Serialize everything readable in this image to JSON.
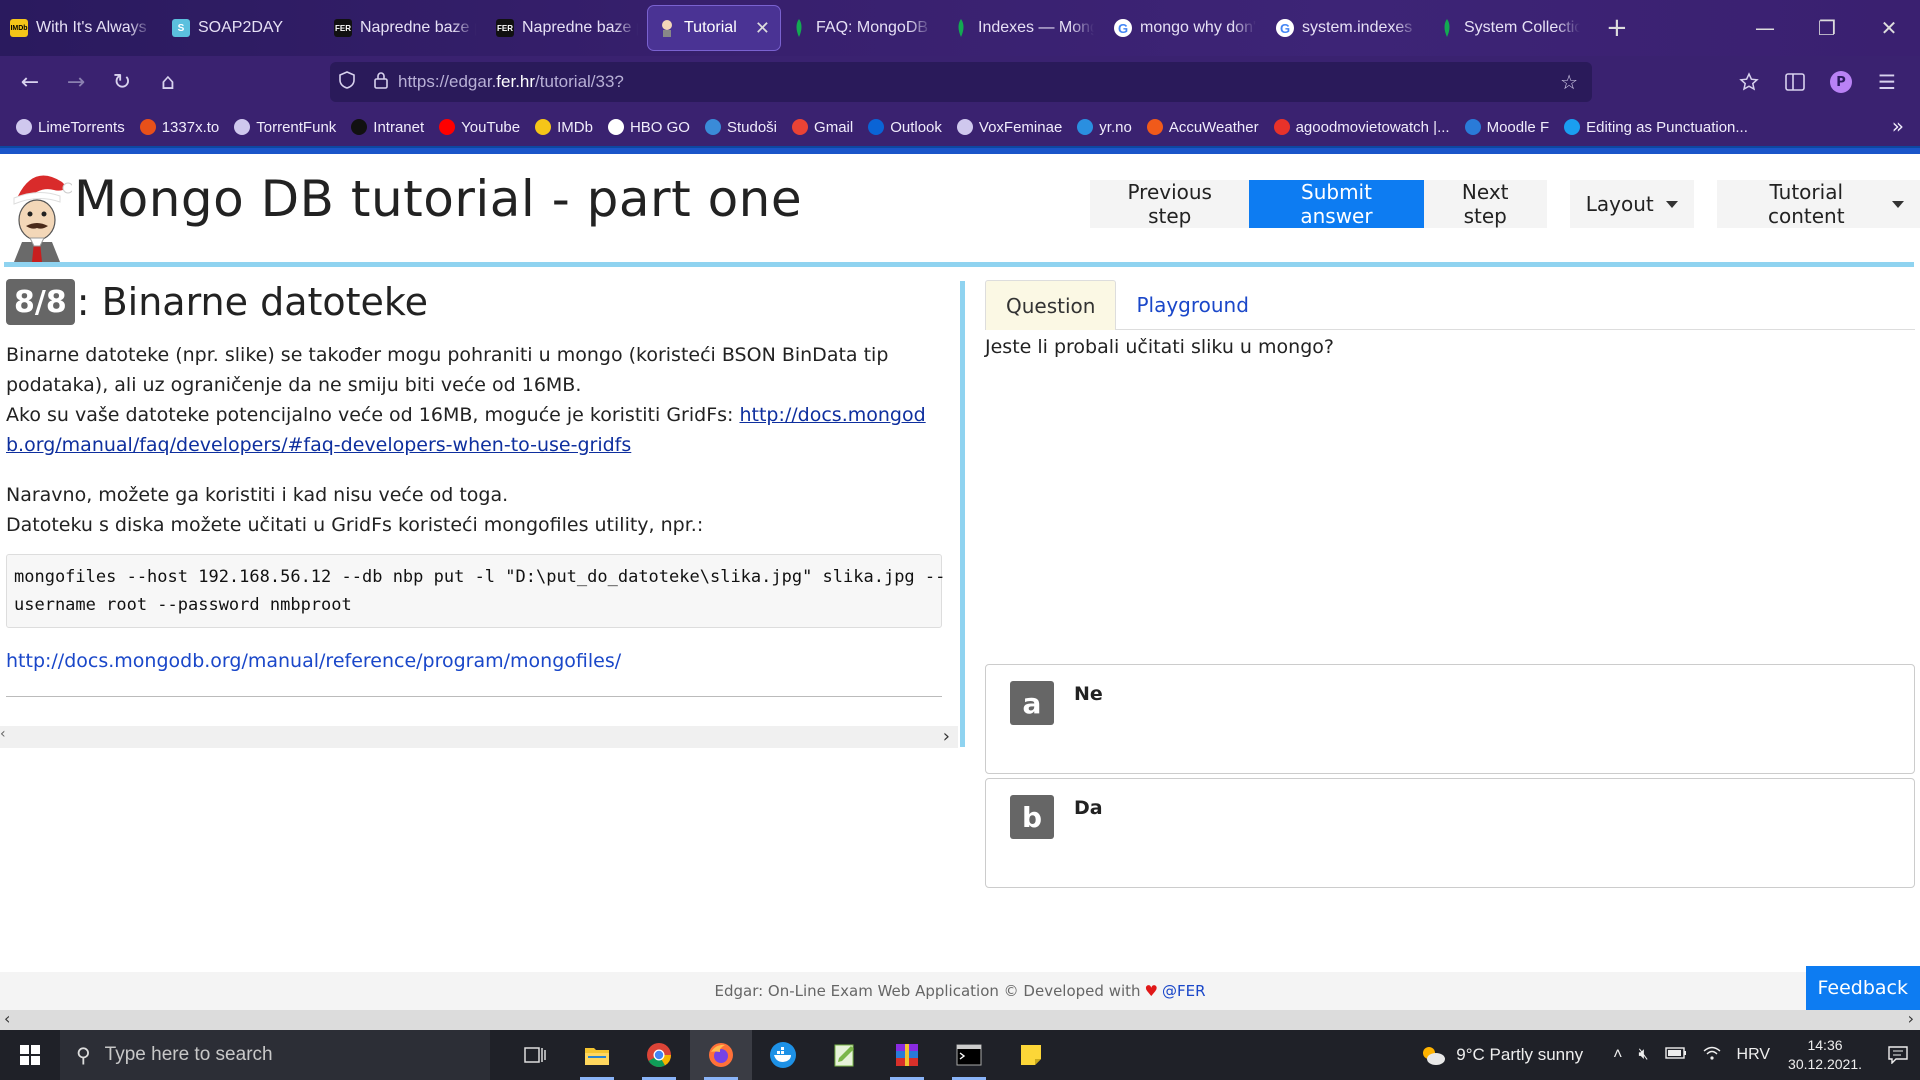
{
  "browser": {
    "tabs": [
      {
        "title": "With It's Always S",
        "favicon": "imdb",
        "color": "#f5c518",
        "active": false
      },
      {
        "title": "SOAP2DAY",
        "favicon": "soap",
        "color": "#5bc0de",
        "active": false
      },
      {
        "title": "Napredne baze p",
        "favicon": "fer",
        "color": "#111111",
        "active": false
      },
      {
        "title": "Napredne baze p",
        "favicon": "fer",
        "color": "#111111",
        "active": false
      },
      {
        "title": "Tutorial",
        "favicon": "edgar",
        "color": "#ffffff",
        "active": true
      },
      {
        "title": "FAQ: MongoDB F",
        "favicon": "mongo",
        "color": "#13aa52",
        "active": false
      },
      {
        "title": "Indexes — Mong",
        "favicon": "mongo",
        "color": "#13aa52",
        "active": false
      },
      {
        "title": "mongo why don't",
        "favicon": "google",
        "color": "#ffffff",
        "active": false
      },
      {
        "title": "system.indexes n",
        "favicon": "google",
        "color": "#ffffff",
        "active": false
      },
      {
        "title": "System Collectio",
        "favicon": "mongo",
        "color": "#13aa52",
        "active": false
      }
    ],
    "new_tab": "+",
    "window": {
      "minimize": "—",
      "restore": "❐",
      "close": "✕"
    },
    "nav": {
      "back": "←",
      "forward": "→",
      "reload": "↻",
      "home": "⌂"
    },
    "url": {
      "prefix": "https://edgar.",
      "domain": "fer.hr",
      "path": "/tutorial/33?"
    },
    "bookmarks": [
      {
        "label": "LimeTorrents",
        "icon": "globe-icon",
        "color": "#cfc8ee"
      },
      {
        "label": "1337x.to",
        "icon": "x-icon",
        "color": "#e8501a"
      },
      {
        "label": "TorrentFunk",
        "icon": "globe-icon",
        "color": "#cfc8ee"
      },
      {
        "label": "Intranet",
        "icon": "fer-icon",
        "color": "#111111"
      },
      {
        "label": "YouTube",
        "icon": "youtube-icon",
        "color": "#ff0000"
      },
      {
        "label": "IMDb",
        "icon": "imdb-icon",
        "color": "#f5c518"
      },
      {
        "label": "HBO GO",
        "icon": "hbo-icon",
        "color": "#ffffff"
      },
      {
        "label": "Studoši",
        "icon": "studosi-icon",
        "color": "#3a8bd8"
      },
      {
        "label": "Gmail",
        "icon": "gmail-icon",
        "color": "#ea4335"
      },
      {
        "label": "Outlook",
        "icon": "outlook-icon",
        "color": "#0a64d6"
      },
      {
        "label": "VoxFeminae",
        "icon": "globe-icon",
        "color": "#cfc8ee"
      },
      {
        "label": "yr.no",
        "icon": "yr-icon",
        "color": "#2a8fe0"
      },
      {
        "label": "AccuWeather",
        "icon": "accuweather-icon",
        "color": "#f05a1a"
      },
      {
        "label": "agoodmovietowatch |...",
        "icon": "movie-icon",
        "color": "#e8322a"
      },
      {
        "label": "Moodle F",
        "icon": "moodle-icon",
        "color": "#2a7bd8"
      },
      {
        "label": "Editing as Punctuation...",
        "icon": "vimeo-icon",
        "color": "#1a9ef0"
      }
    ],
    "bookmarks_more": "»"
  },
  "header": {
    "title": "Mongo DB tutorial - part one",
    "buttons": {
      "previous": "Previous step",
      "submit": "Submit answer",
      "next": "Next step",
      "layout": "Layout",
      "content": "Tutorial content"
    }
  },
  "lesson": {
    "step_badge": "8/8",
    "heading": ": Binarne datoteke",
    "para1_line1": "Binarne datoteke (npr. slike) se također mogu pohraniti u mongo (koristeći BSON BinData tip",
    "para1_line2": "podataka), ali uz ograničenje da ne smiju biti veće od 16MB.",
    "para1_line3": "Ako su vaše datoteke potencijalno veće od 16MB, moguće je koristiti GridFs: ",
    "gridfs_link": "http://docs.mongodb.org/manual/faq/developers/#faq-developers-when-to-use-gridfs",
    "para2_line1": "Naravno, možete ga koristiti i kad nisu veće od toga.",
    "para2_line2": "Datoteku s diska možete učitati u GridFs koristeći mongofiles utility, npr.:",
    "code_line1": "mongofiles --host 192.168.56.12 --db nbp put -l \"D:\\put_do_datoteke\\slika.jpg\" slika.jpg --",
    "code_line2": "username root --password nmbproot",
    "mongofiles_link": "http://docs.mongodb.org/manual/reference/program/mongofiles/"
  },
  "question_panel": {
    "tabs": {
      "question": "Question",
      "playground": "Playground"
    },
    "question_text": "Jeste li probali učitati sliku u mongo?",
    "answers": [
      {
        "letter": "a",
        "text": "Ne"
      },
      {
        "letter": "b",
        "text": "Da"
      }
    ]
  },
  "footer": {
    "text_before": "Edgar: On-Line Exam Web Application © Developed with",
    "heart": "♥",
    "fer": "@FER",
    "feedback": "Feedback"
  },
  "taskbar": {
    "search_placeholder": "Type here to search",
    "weather": "9°C  Partly sunny",
    "language": "HRV",
    "time": "14:36",
    "date": "30.12.2021."
  }
}
